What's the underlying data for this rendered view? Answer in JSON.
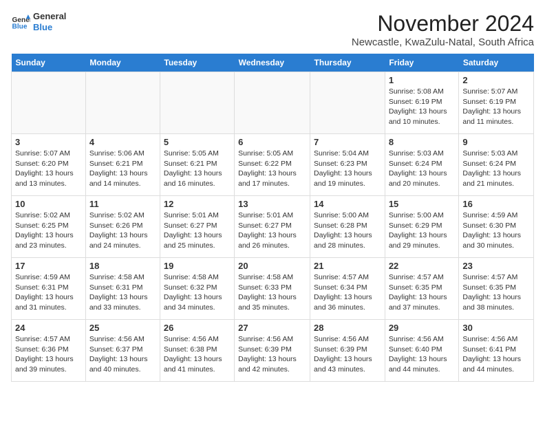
{
  "logo": {
    "line1": "General",
    "line2": "Blue"
  },
  "title": "November 2024",
  "subtitle": "Newcastle, KwaZulu-Natal, South Africa",
  "headers": [
    "Sunday",
    "Monday",
    "Tuesday",
    "Wednesday",
    "Thursday",
    "Friday",
    "Saturday"
  ],
  "weeks": [
    [
      {
        "day": "",
        "content": ""
      },
      {
        "day": "",
        "content": ""
      },
      {
        "day": "",
        "content": ""
      },
      {
        "day": "",
        "content": ""
      },
      {
        "day": "",
        "content": ""
      },
      {
        "day": "1",
        "content": "Sunrise: 5:08 AM\nSunset: 6:19 PM\nDaylight: 13 hours and 10 minutes."
      },
      {
        "day": "2",
        "content": "Sunrise: 5:07 AM\nSunset: 6:19 PM\nDaylight: 13 hours and 11 minutes."
      }
    ],
    [
      {
        "day": "3",
        "content": "Sunrise: 5:07 AM\nSunset: 6:20 PM\nDaylight: 13 hours and 13 minutes."
      },
      {
        "day": "4",
        "content": "Sunrise: 5:06 AM\nSunset: 6:21 PM\nDaylight: 13 hours and 14 minutes."
      },
      {
        "day": "5",
        "content": "Sunrise: 5:05 AM\nSunset: 6:21 PM\nDaylight: 13 hours and 16 minutes."
      },
      {
        "day": "6",
        "content": "Sunrise: 5:05 AM\nSunset: 6:22 PM\nDaylight: 13 hours and 17 minutes."
      },
      {
        "day": "7",
        "content": "Sunrise: 5:04 AM\nSunset: 6:23 PM\nDaylight: 13 hours and 19 minutes."
      },
      {
        "day": "8",
        "content": "Sunrise: 5:03 AM\nSunset: 6:24 PM\nDaylight: 13 hours and 20 minutes."
      },
      {
        "day": "9",
        "content": "Sunrise: 5:03 AM\nSunset: 6:24 PM\nDaylight: 13 hours and 21 minutes."
      }
    ],
    [
      {
        "day": "10",
        "content": "Sunrise: 5:02 AM\nSunset: 6:25 PM\nDaylight: 13 hours and 23 minutes."
      },
      {
        "day": "11",
        "content": "Sunrise: 5:02 AM\nSunset: 6:26 PM\nDaylight: 13 hours and 24 minutes."
      },
      {
        "day": "12",
        "content": "Sunrise: 5:01 AM\nSunset: 6:27 PM\nDaylight: 13 hours and 25 minutes."
      },
      {
        "day": "13",
        "content": "Sunrise: 5:01 AM\nSunset: 6:27 PM\nDaylight: 13 hours and 26 minutes."
      },
      {
        "day": "14",
        "content": "Sunrise: 5:00 AM\nSunset: 6:28 PM\nDaylight: 13 hours and 28 minutes."
      },
      {
        "day": "15",
        "content": "Sunrise: 5:00 AM\nSunset: 6:29 PM\nDaylight: 13 hours and 29 minutes."
      },
      {
        "day": "16",
        "content": "Sunrise: 4:59 AM\nSunset: 6:30 PM\nDaylight: 13 hours and 30 minutes."
      }
    ],
    [
      {
        "day": "17",
        "content": "Sunrise: 4:59 AM\nSunset: 6:31 PM\nDaylight: 13 hours and 31 minutes."
      },
      {
        "day": "18",
        "content": "Sunrise: 4:58 AM\nSunset: 6:31 PM\nDaylight: 13 hours and 33 minutes."
      },
      {
        "day": "19",
        "content": "Sunrise: 4:58 AM\nSunset: 6:32 PM\nDaylight: 13 hours and 34 minutes."
      },
      {
        "day": "20",
        "content": "Sunrise: 4:58 AM\nSunset: 6:33 PM\nDaylight: 13 hours and 35 minutes."
      },
      {
        "day": "21",
        "content": "Sunrise: 4:57 AM\nSunset: 6:34 PM\nDaylight: 13 hours and 36 minutes."
      },
      {
        "day": "22",
        "content": "Sunrise: 4:57 AM\nSunset: 6:35 PM\nDaylight: 13 hours and 37 minutes."
      },
      {
        "day": "23",
        "content": "Sunrise: 4:57 AM\nSunset: 6:35 PM\nDaylight: 13 hours and 38 minutes."
      }
    ],
    [
      {
        "day": "24",
        "content": "Sunrise: 4:57 AM\nSunset: 6:36 PM\nDaylight: 13 hours and 39 minutes."
      },
      {
        "day": "25",
        "content": "Sunrise: 4:56 AM\nSunset: 6:37 PM\nDaylight: 13 hours and 40 minutes."
      },
      {
        "day": "26",
        "content": "Sunrise: 4:56 AM\nSunset: 6:38 PM\nDaylight: 13 hours and 41 minutes."
      },
      {
        "day": "27",
        "content": "Sunrise: 4:56 AM\nSunset: 6:39 PM\nDaylight: 13 hours and 42 minutes."
      },
      {
        "day": "28",
        "content": "Sunrise: 4:56 AM\nSunset: 6:39 PM\nDaylight: 13 hours and 43 minutes."
      },
      {
        "day": "29",
        "content": "Sunrise: 4:56 AM\nSunset: 6:40 PM\nDaylight: 13 hours and 44 minutes."
      },
      {
        "day": "30",
        "content": "Sunrise: 4:56 AM\nSunset: 6:41 PM\nDaylight: 13 hours and 44 minutes."
      }
    ]
  ]
}
